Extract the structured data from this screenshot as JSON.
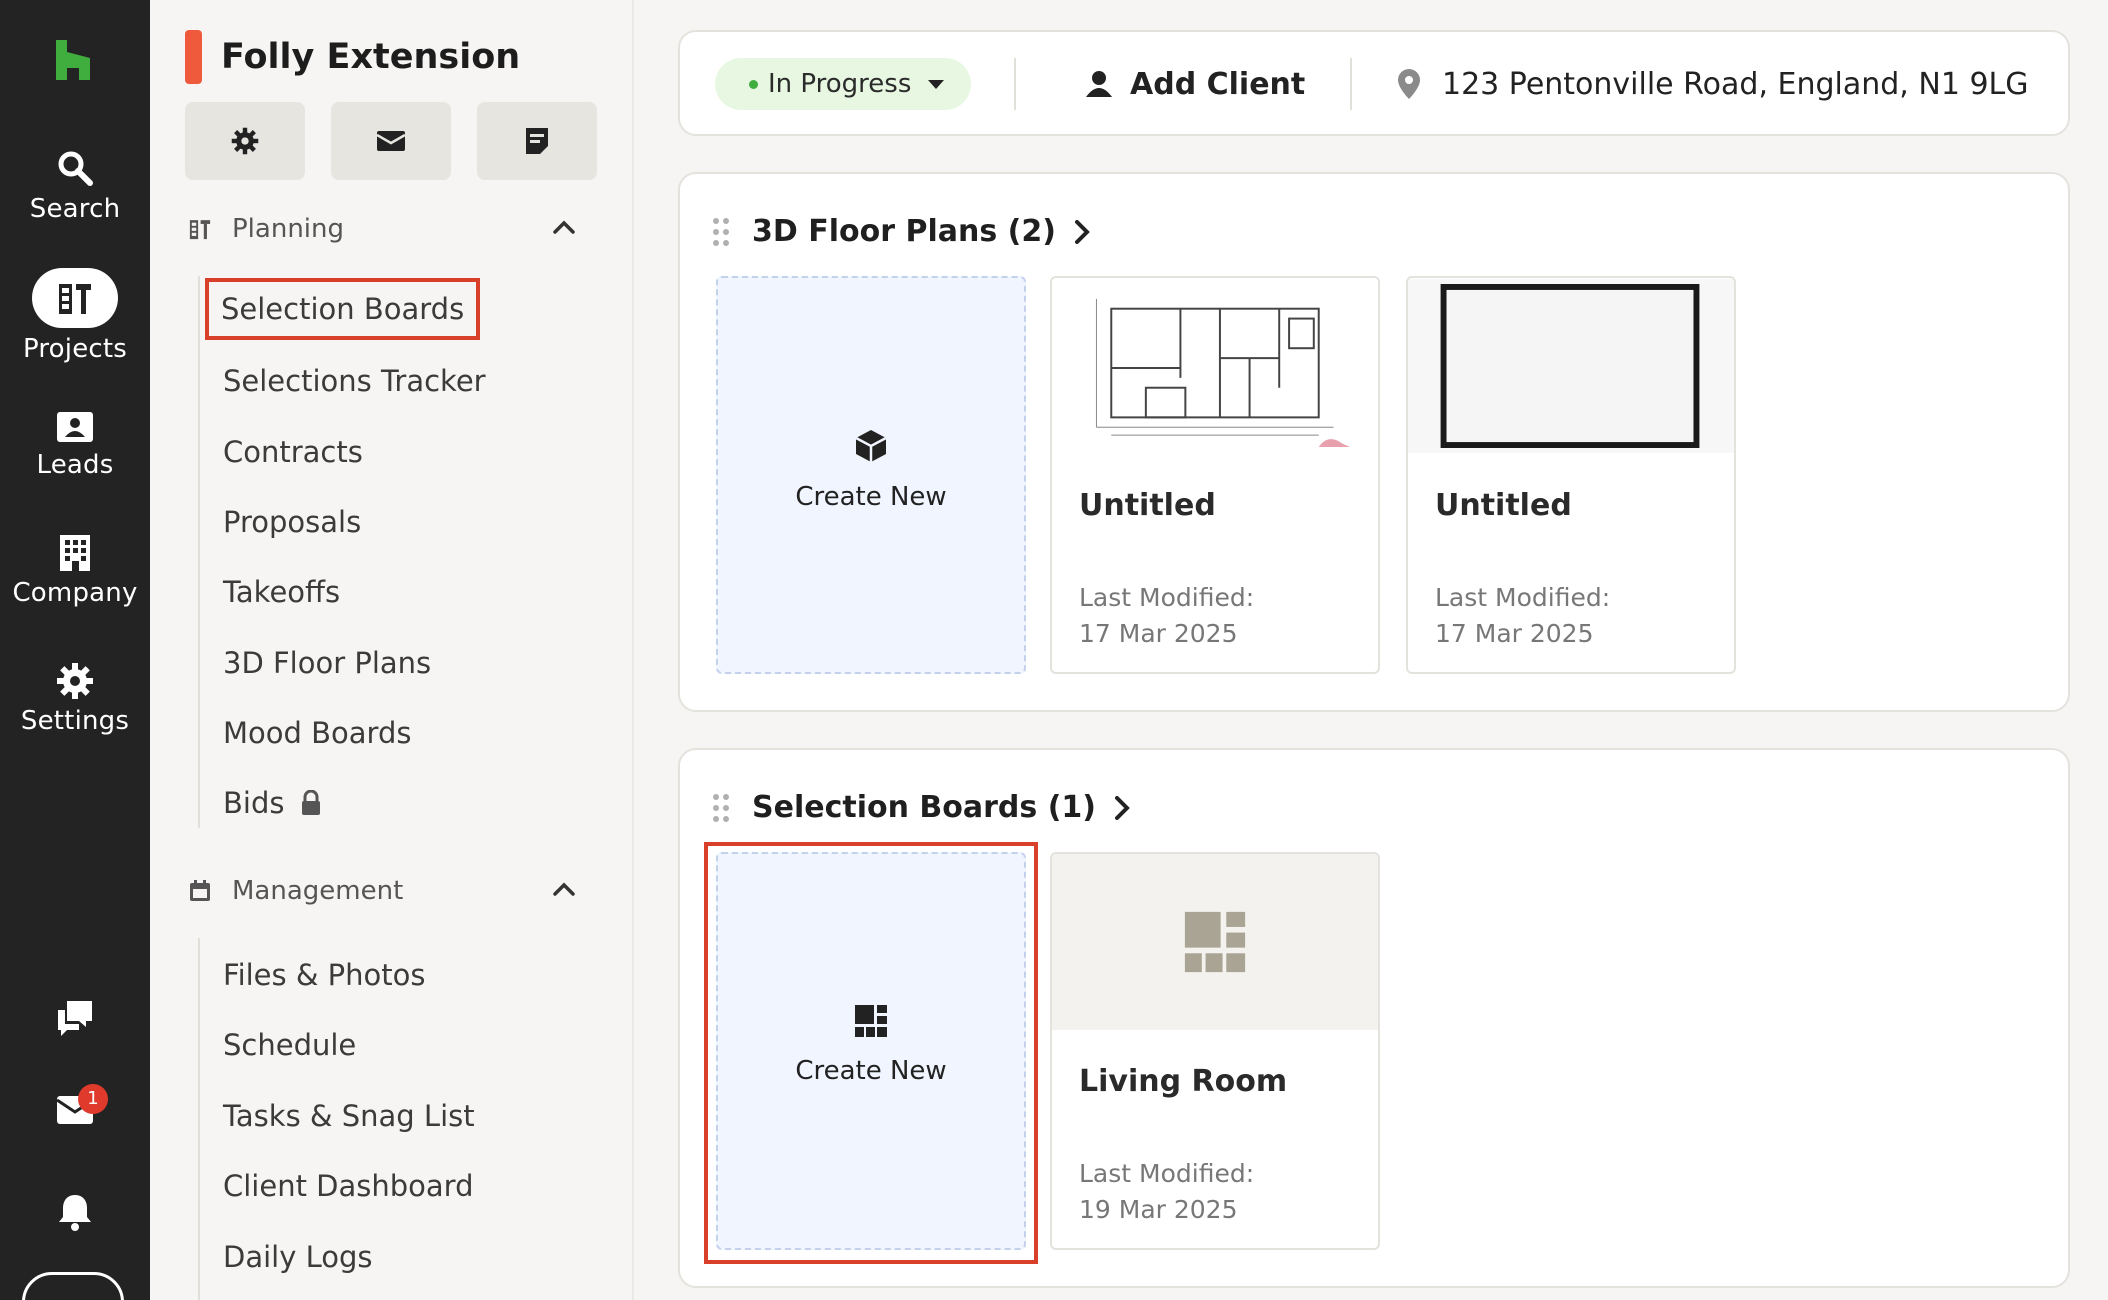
{
  "colors": {
    "rail_bg": "#232323",
    "brand_green": "#3fae3f",
    "project_accent": "#ef5a3c",
    "highlight_red": "#d9402a",
    "create_tile_bg": "#f0f5ff"
  },
  "rail": {
    "items": [
      {
        "label": "Search",
        "icon": "search-icon"
      },
      {
        "label": "Projects",
        "icon": "projects-icon"
      },
      {
        "label": "Leads",
        "icon": "leads-icon"
      },
      {
        "label": "Company",
        "icon": "building-icon"
      },
      {
        "label": "Settings",
        "icon": "gear-icon"
      }
    ],
    "footer": {
      "messages_icon": "chat-icon",
      "inbox_icon": "inbox-icon",
      "inbox_badge": "1",
      "notifications_icon": "bell-icon"
    }
  },
  "project": {
    "title": "Folly Extension",
    "toolbar": [
      {
        "icon": "gear-icon"
      },
      {
        "icon": "mail-icon"
      },
      {
        "icon": "notes-icon"
      }
    ],
    "sections": [
      {
        "title": "Planning",
        "items": [
          "Selection Boards",
          "Selections Tracker",
          "Contracts",
          "Proposals",
          "Takeoffs",
          "3D Floor Plans",
          "Mood Boards",
          "Bids"
        ]
      },
      {
        "title": "Management",
        "items": [
          "Files & Photos",
          "Schedule",
          "Tasks & Snag List",
          "Client Dashboard",
          "Daily Logs"
        ]
      }
    ]
  },
  "header": {
    "status": "In Progress",
    "add_client": "Add Client",
    "address": "123 Pentonville Road, England, N1 9LG"
  },
  "floor_plans": {
    "title": "3D Floor Plans (2)",
    "create_label": "Create New",
    "items": [
      {
        "name": "Untitled",
        "modified_label": "Last Modified:",
        "modified_date": "17 Mar 2025"
      },
      {
        "name": "Untitled",
        "modified_label": "Last Modified:",
        "modified_date": "17 Mar 2025"
      }
    ]
  },
  "selection_boards": {
    "title": "Selection Boards (1)",
    "create_label": "Create New",
    "items": [
      {
        "name": "Living Room",
        "modified_label": "Last Modified:",
        "modified_date": "19 Mar 2025"
      }
    ]
  }
}
